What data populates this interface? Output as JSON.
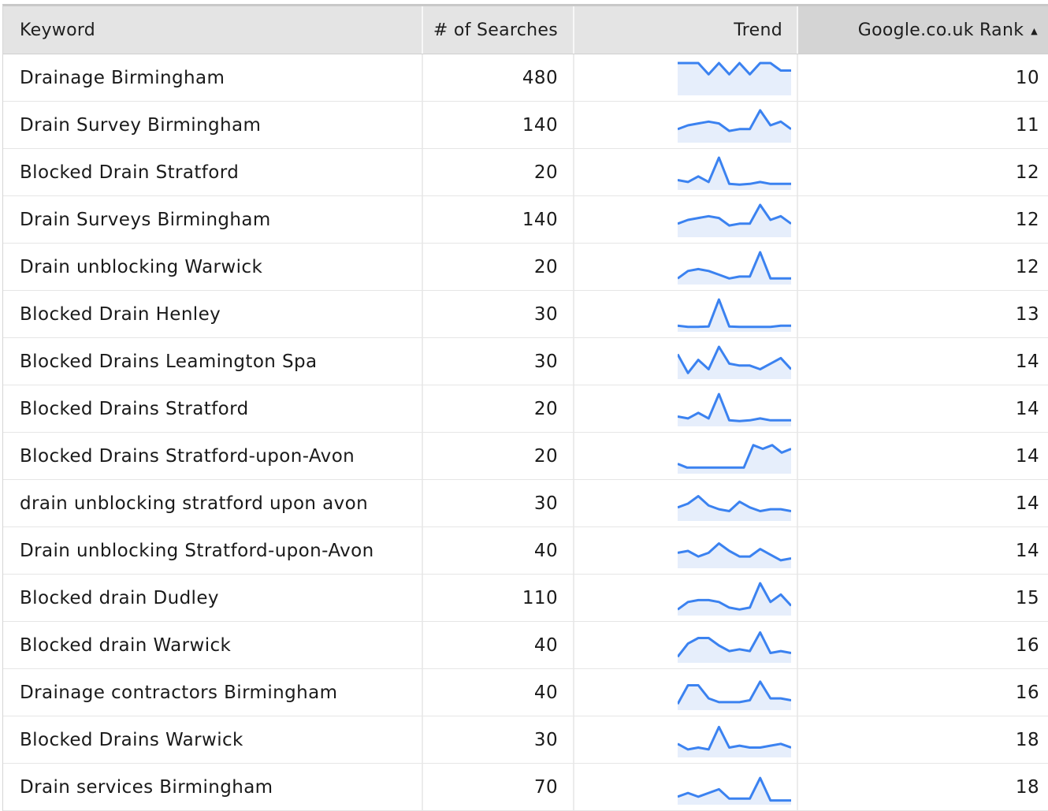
{
  "table": {
    "headers": {
      "keyword": "Keyword",
      "searches": "# of Searches",
      "trend": "Trend",
      "rank": "Google.co.uk Rank"
    },
    "sort_indicator": "▲",
    "sorted_column": "rank",
    "sort_direction": "ascending",
    "trend_color": "#3b82f0",
    "trend_fill": "#e6eefb",
    "rows": [
      {
        "keyword": "Drainage Birmingham",
        "searches": "480",
        "rank": "10",
        "trend": [
          8,
          8,
          8,
          5,
          8,
          5,
          8,
          5,
          8,
          8,
          6,
          6
        ]
      },
      {
        "keyword": "Drain Survey Birmingham",
        "searches": "140",
        "rank": "11",
        "trend": [
          3,
          4,
          4.5,
          5,
          4.5,
          2.5,
          3,
          3,
          8,
          4,
          5,
          3
        ]
      },
      {
        "keyword": "Blocked Drain Stratford",
        "searches": "20",
        "rank": "12",
        "trend": [
          2,
          1.5,
          3,
          1.5,
          8,
          1,
          0.8,
          1,
          1.5,
          1,
          1,
          1
        ]
      },
      {
        "keyword": "Drain Surveys Birmingham",
        "searches": "140",
        "rank": "12",
        "trend": [
          3,
          4,
          4.5,
          5,
          4.5,
          2.5,
          3,
          3,
          8,
          4,
          5,
          3
        ]
      },
      {
        "keyword": "Drain unblocking Warwick",
        "searches": "20",
        "rank": "12",
        "trend": [
          1,
          3,
          3.5,
          3,
          2,
          1,
          1.5,
          1.5,
          8,
          1,
          1,
          1
        ]
      },
      {
        "keyword": "Blocked Drain Henley",
        "searches": "30",
        "rank": "13",
        "trend": [
          1,
          0.7,
          0.7,
          0.8,
          8,
          0.8,
          0.7,
          0.7,
          0.7,
          0.7,
          1,
          1
        ]
      },
      {
        "keyword": "Blocked Drains Leamington Spa",
        "searches": "30",
        "rank": "14",
        "trend": [
          6,
          1,
          4.5,
          2,
          8,
          3.5,
          3,
          3,
          2,
          3.5,
          5,
          2
        ]
      },
      {
        "keyword": "Blocked Drains Stratford",
        "searches": "20",
        "rank": "14",
        "trend": [
          2,
          1.5,
          3,
          1.5,
          8,
          1,
          0.8,
          1,
          1.5,
          1,
          1,
          1
        ]
      },
      {
        "keyword": "Blocked Drains Stratford-upon-Avon",
        "searches": "20",
        "rank": "14",
        "trend": [
          2,
          1,
          1,
          1,
          1,
          1,
          1,
          1,
          7,
          6,
          7,
          5,
          6
        ]
      },
      {
        "keyword": "drain unblocking stratford upon avon",
        "searches": "30",
        "rank": "14",
        "trend": [
          3,
          4,
          6,
          3.5,
          2.5,
          2,
          4.5,
          3,
          2,
          2.5,
          2.5,
          2
        ]
      },
      {
        "keyword": "Drain unblocking Stratford-upon-Avon",
        "searches": "40",
        "rank": "14",
        "trend": [
          3.5,
          4,
          2.5,
          3.5,
          6,
          4,
          2.5,
          2.5,
          4.5,
          3,
          1.5,
          2
        ]
      },
      {
        "keyword": "Blocked drain Dudley",
        "searches": "110",
        "rank": "15",
        "trend": [
          1,
          3,
          3.5,
          3.5,
          3,
          1.5,
          1,
          1.5,
          8,
          3,
          5,
          2
        ]
      },
      {
        "keyword": "Blocked drain Warwick",
        "searches": "40",
        "rank": "16",
        "trend": [
          1,
          4.5,
          6,
          6,
          4,
          2.5,
          3,
          2.5,
          7.5,
          2,
          2.5,
          2
        ]
      },
      {
        "keyword": "Drainage contractors Birmingham",
        "searches": "40",
        "rank": "16",
        "trend": [
          1,
          6,
          6,
          2.5,
          1.5,
          1.5,
          1.5,
          2,
          7,
          2.5,
          2.5,
          2
        ]
      },
      {
        "keyword": "Blocked Drains Warwick",
        "searches": "30",
        "rank": "18",
        "trend": [
          3,
          1.5,
          2,
          1.5,
          7.5,
          2,
          2.5,
          2,
          2,
          2.5,
          3,
          2
        ]
      },
      {
        "keyword": "Drain services Birmingham",
        "searches": "70",
        "rank": "18",
        "trend": [
          1.5,
          2.5,
          1.5,
          2.5,
          3.5,
          1,
          1,
          1,
          6.5,
          0.5,
          0.5,
          0.5
        ]
      }
    ]
  }
}
